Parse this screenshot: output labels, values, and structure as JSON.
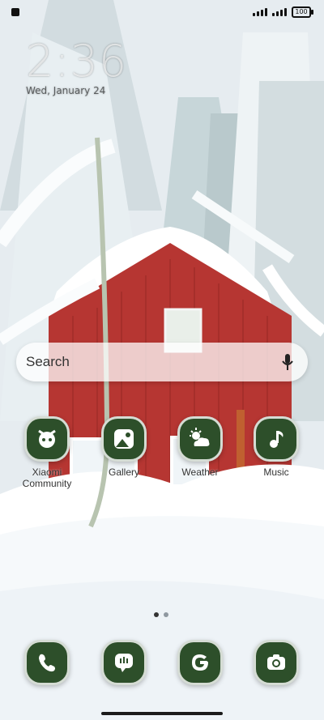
{
  "status_bar": {
    "signal_bars": 4,
    "battery": "100"
  },
  "clock": {
    "time": "2:36",
    "date": "Wed, January 24"
  },
  "search": {
    "label": "Search"
  },
  "home_apps": [
    {
      "label": "Xiaomi Community",
      "icon": "xiaomi-community-icon"
    },
    {
      "label": "Gallery",
      "icon": "gallery-icon"
    },
    {
      "label": "Weather",
      "icon": "weather-icon"
    },
    {
      "label": "Music",
      "icon": "music-icon"
    }
  ],
  "pager": {
    "pages": 2,
    "current": 1
  },
  "dock": [
    {
      "label": "Phone",
      "icon": "phone-icon"
    },
    {
      "label": "Messages",
      "icon": "message-icon"
    },
    {
      "label": "Google",
      "icon": "google-icon"
    },
    {
      "label": "Camera",
      "icon": "camera-icon"
    }
  ],
  "colors": {
    "icon_bg": "#2d4f2a",
    "icon_fg": "#ffffff"
  }
}
